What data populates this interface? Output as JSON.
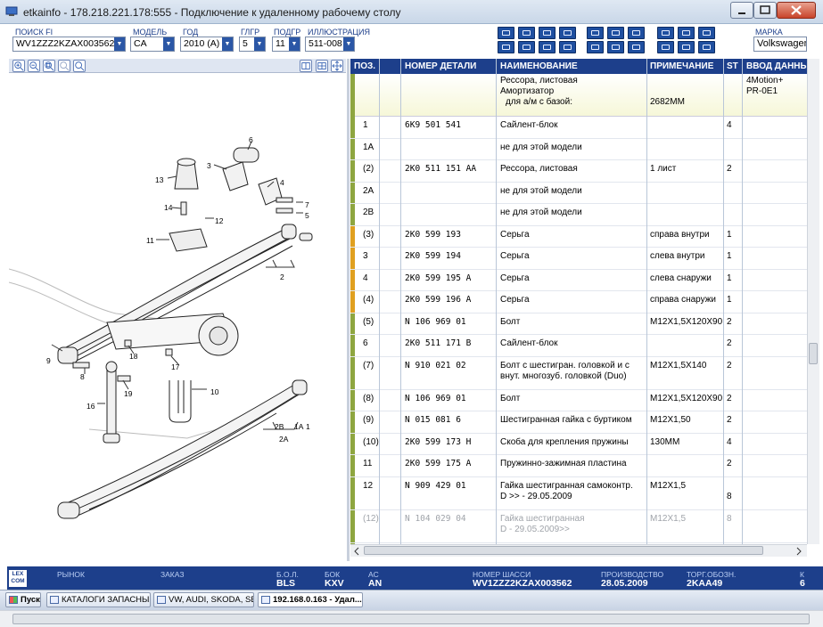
{
  "window": {
    "title": "etkainfo - 178.218.221.178:555 - Подключение к удаленному рабочему столу"
  },
  "filters": {
    "search_label": "ПОИСК FI",
    "search_value": "WV1ZZZ2KZAX003562",
    "model_label": "МОДЕЛЬ",
    "model_value": "CA",
    "year_label": "ГОД",
    "year_value": "2010 (A)",
    "main_group_label": "ГЛГР",
    "main_group_value": "5",
    "sub_group_label": "ПОДГР",
    "sub_group_value": "11",
    "illustration_label": "ИЛЛЮСТРАЦИЯ",
    "illustration_value": "511-008",
    "brand_label": "МАРКА",
    "brand_value": "Volkswagen"
  },
  "toolbar_icons": [
    "print-icon",
    "search-doc-icon",
    "link-icon",
    "car-icon",
    "truck-icon",
    "info-icon",
    "cart-icon",
    "cart-icon",
    "doc-icon",
    "key-icon",
    "settings-icon",
    "arrow-icon",
    "monitor-icon",
    "monitor-icon",
    "pin-icon",
    "back-forward-icon",
    "first-icon",
    "prev-icon",
    "next-icon",
    "last-icon"
  ],
  "table": {
    "headers": {
      "pos": "ПОЗ.",
      "part_number": "НОМЕР ДЕТАЛИ",
      "name": "НАИМЕНОВАНИЕ",
      "note": "ПРИМЕЧАНИЕ",
      "st": "ST",
      "input": "ВВОД ДАННЫ"
    },
    "info": {
      "line1": "Рессора, листовая",
      "line2": "Амортизатор",
      "line3": "для а/м с базой:",
      "note": "2682MM",
      "input1": "4Motion+",
      "input2": "PR-0E1"
    },
    "rows": [
      {
        "pos": "1",
        "part": "6K9  501  541",
        "name": "Сайлент-блок",
        "name2": "",
        "note": "",
        "st": "4",
        "marker": "#8ea640",
        "grey": false
      },
      {
        "pos": "1A",
        "part": "",
        "name": "не для этой модели",
        "name2": "",
        "note": "",
        "st": "",
        "marker": "#8ea640",
        "grey": false
      },
      {
        "pos": "(2)",
        "part": "2K0  511  151 AA",
        "name": "Рессора, листовая",
        "name2": "",
        "note": "1 лист",
        "st": "2",
        "marker": "#8ea640",
        "grey": false
      },
      {
        "pos": "2A",
        "part": "",
        "name": "не для этой модели",
        "name2": "",
        "note": "",
        "st": "",
        "marker": "#8ea640",
        "grey": false
      },
      {
        "pos": "2B",
        "part": "",
        "name": "не для этой модели",
        "name2": "",
        "note": "",
        "st": "",
        "marker": "#8ea640",
        "grey": false
      },
      {
        "pos": "(3)",
        "part": "2K0  599  193",
        "name": "Серьга",
        "name2": "",
        "note": "справа внутри",
        "st": "1",
        "marker": "#e0a020",
        "grey": false
      },
      {
        "pos": "3",
        "part": "2K0  599  194",
        "name": "Серьга",
        "name2": "",
        "note": "слева внутри",
        "st": "1",
        "marker": "#e0a020",
        "grey": false
      },
      {
        "pos": "4",
        "part": "2K0  599  195 A",
        "name": "Серьга",
        "name2": "",
        "note": "слева снаружи",
        "st": "1",
        "marker": "#e0a020",
        "grey": false
      },
      {
        "pos": "(4)",
        "part": "2K0  599  196 A",
        "name": "Серьга",
        "name2": "",
        "note": "справа снаружи",
        "st": "1",
        "marker": "#e0a020",
        "grey": false
      },
      {
        "pos": "(5)",
        "part": "N   106  969  01",
        "name": "Болт",
        "name2": "",
        "note": "M12X1,5X120X90",
        "st": "2",
        "marker": "#8ea640",
        "grey": false
      },
      {
        "pos": "6",
        "part": "2K0  511  171 B",
        "name": "Сайлент-блок",
        "name2": "",
        "note": "",
        "st": "2",
        "marker": "#8ea640",
        "grey": false
      },
      {
        "pos": "(7)",
        "part": "N   910  021  02",
        "name": "Болт с шестигран. головкой и с",
        "name2": "внут. многозуб. головкой (Duo)",
        "note": "M12X1,5X140",
        "st": "2",
        "marker": "#8ea640",
        "grey": false
      },
      {
        "pos": "(8)",
        "part": "N   106  969  01",
        "name": "Болт",
        "name2": "",
        "note": "M12X1,5X120X90",
        "st": "2",
        "marker": "#8ea640",
        "grey": false
      },
      {
        "pos": "(9)",
        "part": "N   015  081  6",
        "name": "Шестигранная гайка с буртиком",
        "name2": "",
        "note": "M12X1,50",
        "st": "2",
        "marker": "#8ea640",
        "grey": false
      },
      {
        "pos": "(10)",
        "part": "2K0  599  173 H",
        "name": "Скоба для крепления пружины",
        "name2": "",
        "note": "130MM",
        "st": "4",
        "marker": "#8ea640",
        "grey": false
      },
      {
        "pos": "11",
        "part": "2K0  599  175 A",
        "name": "Пружинно-зажимная пластина",
        "name2": "",
        "note": "",
        "st": "2",
        "marker": "#8ea640",
        "grey": false
      },
      {
        "pos": "12",
        "part": "N   909  429  01",
        "name": "Гайка шестигранная самоконтр.",
        "name2": "D         >> - 29.05.2009",
        "note": "M12X1,5",
        "st": "8",
        "marker": "#8ea640",
        "grey": false
      },
      {
        "pos": "(12)",
        "part": "N   104  029  04",
        "name": "Гайка шестигранная",
        "name2": "D - 29.05.2009>>",
        "note": "M12X1,5",
        "st": "8",
        "marker": "#8ea640",
        "grey": true
      }
    ]
  },
  "diagram": {
    "callouts": [
      "6",
      "3",
      "4",
      "13",
      "7",
      "5",
      "14",
      "12",
      "11",
      "2",
      "9",
      "8",
      "18",
      "17",
      "10",
      "19",
      "16",
      "2B",
      "2A",
      "1A",
      "1"
    ]
  },
  "status": {
    "logo_line1": "LEX",
    "logo_line2": "COM",
    "market_label": "РЫНОК",
    "order_label": "ЗАКАЗ",
    "bol_label": "Б.О.Л.",
    "bol_value": "BLS",
    "bok_label": "БОК",
    "bok_value": "KXV",
    "ac_label": "AC",
    "ac_value": "AN",
    "chassis_label": "НОМЕР ШАССИ",
    "chassis_value": "WV1ZZZ2KZAX003562",
    "production_label": "ПРОИЗВОДСТВО",
    "production_value": "28.05.2009",
    "trade_label": "ТОРГ.ОБОЗН.",
    "trade_value": "2KAA49",
    "k_label": "К",
    "k_value": "6"
  },
  "taskbar": {
    "start_label": "Пуск",
    "items": [
      "КАТАЛОГИ ЗАПАСНЫХ ...",
      "VW, AUDI, SKODA, SEAT",
      "192.168.0.163 - Удал..."
    ]
  }
}
